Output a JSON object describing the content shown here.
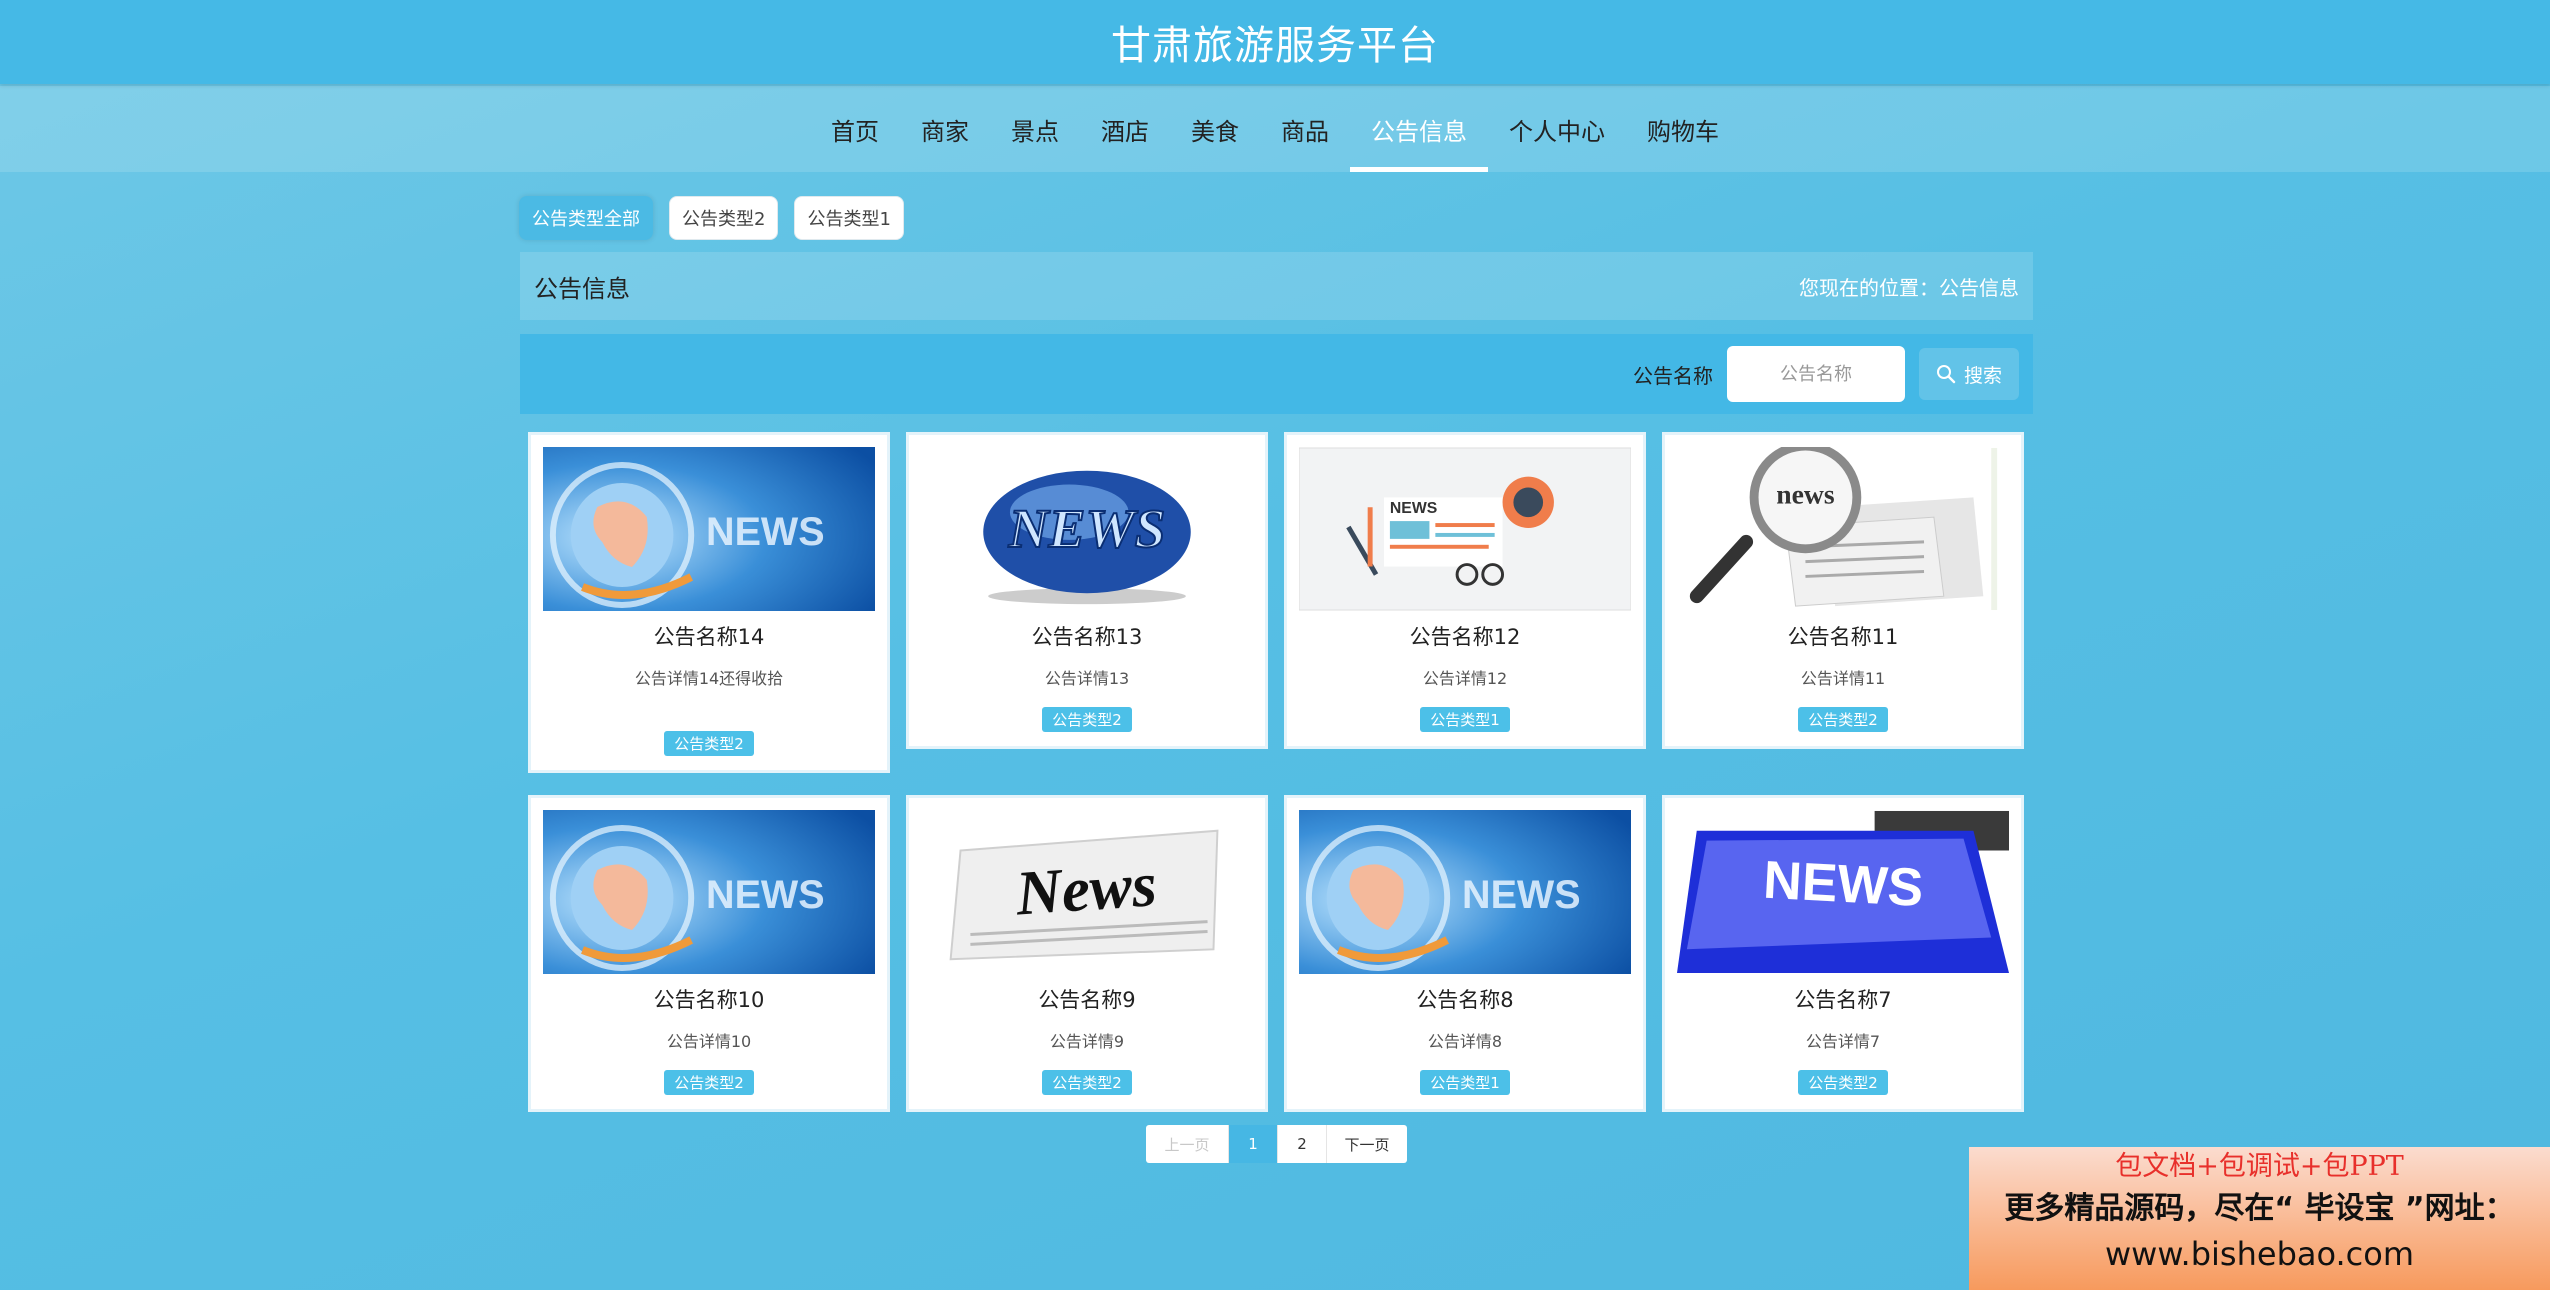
{
  "header": {
    "title": "甘肃旅游服务平台"
  },
  "nav": {
    "items": [
      {
        "label": "首页",
        "active": false
      },
      {
        "label": "商家",
        "active": false
      },
      {
        "label": "景点",
        "active": false
      },
      {
        "label": "酒店",
        "active": false
      },
      {
        "label": "美食",
        "active": false
      },
      {
        "label": "商品",
        "active": false
      },
      {
        "label": "公告信息",
        "active": true
      },
      {
        "label": "个人中心",
        "active": false
      },
      {
        "label": "购物车",
        "active": false
      }
    ]
  },
  "filters": [
    {
      "label": "公告类型全部",
      "active": true
    },
    {
      "label": "公告类型2",
      "active": false
    },
    {
      "label": "公告类型1",
      "active": false
    }
  ],
  "section": {
    "title": "公告信息",
    "breadcrumb": "您现在的位置：公告信息"
  },
  "search": {
    "label": "公告名称",
    "placeholder": "公告名称",
    "button": "搜索"
  },
  "cards": [
    {
      "title": "公告名称14",
      "desc": "公告详情14还得收拾",
      "tag": "公告类型2",
      "image": "news-globe-blue"
    },
    {
      "title": "公告名称13",
      "desc": "公告详情13",
      "tag": "公告类型2",
      "image": "news-earth-logo"
    },
    {
      "title": "公告名称12",
      "desc": "公告详情12",
      "tag": "公告类型1",
      "image": "news-paper-illustration"
    },
    {
      "title": "公告名称11",
      "desc": "公告详情11",
      "tag": "公告类型2",
      "image": "news-magnifier"
    },
    {
      "title": "公告名称10",
      "desc": "公告详情10",
      "tag": "公告类型2",
      "image": "news-globe-blue"
    },
    {
      "title": "公告名称9",
      "desc": "公告详情9",
      "tag": "公告类型2",
      "image": "news-newspaper"
    },
    {
      "title": "公告名称8",
      "desc": "公告详情8",
      "tag": "公告类型1",
      "image": "news-globe-blue"
    },
    {
      "title": "公告名称7",
      "desc": "公告详情7",
      "tag": "公告类型2",
      "image": "news-keyboard-key"
    }
  ],
  "pager": {
    "prev": "上一页",
    "pages": [
      "1",
      "2"
    ],
    "current": "1",
    "next": "下一页"
  },
  "watermark": {
    "line1": "包文档+包调试+包PPT",
    "line2": "更多精品源码，尽在“ 毕设宝 ”网址：",
    "line3": "www.bishebao.com"
  }
}
